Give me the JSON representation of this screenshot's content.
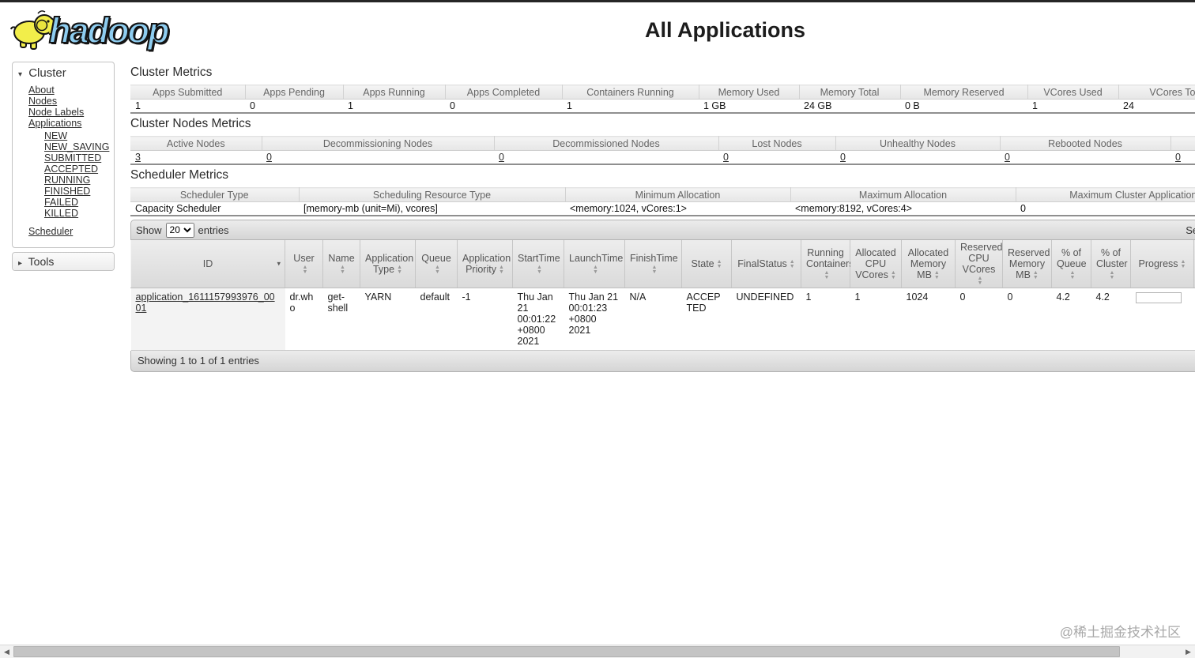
{
  "page": {
    "title": "All Applications",
    "watermark": "@稀土掘金技术社区"
  },
  "logo": {
    "brand": "hadoop",
    "colors": {
      "text_fill": "#8ecdf0",
      "elephant": "#f2ee4a",
      "outline": "#141414"
    }
  },
  "sidebar": {
    "cluster": {
      "label": "Cluster",
      "items": [
        "About",
        "Nodes",
        "Node Labels",
        "Applications"
      ],
      "app_states": [
        "NEW",
        "NEW_SAVING",
        "SUBMITTED",
        "ACCEPTED",
        "RUNNING",
        "FINISHED",
        "FAILED",
        "KILLED"
      ],
      "footer_item": "Scheduler"
    },
    "tools": {
      "label": "Tools"
    }
  },
  "cluster_metrics": {
    "heading": "Cluster Metrics",
    "columns": [
      "Apps Submitted",
      "Apps Pending",
      "Apps Running",
      "Apps Completed",
      "Containers Running",
      "Memory Used",
      "Memory Total",
      "Memory Reserved",
      "VCores Used",
      "VCores Total"
    ],
    "values": [
      "1",
      "0",
      "1",
      "0",
      "1",
      "1 GB",
      "24 GB",
      "0 B",
      "1",
      "24"
    ]
  },
  "cluster_nodes_metrics": {
    "heading": "Cluster Nodes Metrics",
    "columns": [
      "Active Nodes",
      "Decommissioning Nodes",
      "Decommissioned Nodes",
      "Lost Nodes",
      "Unhealthy Nodes",
      "Rebooted Nodes"
    ],
    "values": [
      "3",
      "0",
      "0",
      "0",
      "0",
      "0",
      "0"
    ]
  },
  "scheduler_metrics": {
    "heading": "Scheduler Metrics",
    "columns": [
      "Scheduler Type",
      "Scheduling Resource Type",
      "Minimum Allocation",
      "Maximum Allocation",
      "Maximum Cluster Application Priority"
    ],
    "values": [
      "Capacity Scheduler",
      "[memory-mb (unit=Mi), vcores]",
      "<memory:1024, vCores:1>",
      "<memory:8192, vCores:4>",
      "0"
    ]
  },
  "apps_table": {
    "show_label": "Show",
    "page_size": "20",
    "entries_label": "entries",
    "search_label": "Search:",
    "columns": [
      "ID",
      "User",
      "Name",
      "Application Type",
      "Queue",
      "Application Priority",
      "StartTime",
      "LaunchTime",
      "FinishTime",
      "State",
      "FinalStatus",
      "Running Containers",
      "Allocated CPU VCores",
      "Allocated Memory MB",
      "Reserved CPU VCores",
      "Reserved Memory MB",
      "% of Queue",
      "% of Cluster",
      "Progress"
    ],
    "row": {
      "id": "application_1611157993976_0001",
      "user": "dr.who",
      "name": "get-shell",
      "application_type": "YARN",
      "queue": "default",
      "application_priority": "-1",
      "start_time": "Thu Jan 21 00:01:22 +0800 2021",
      "launch_time": "Thu Jan 21 00:01:23 +0800 2021",
      "finish_time": "N/A",
      "state": "ACCEPTED",
      "final_status": "UNDEFINED",
      "running_containers": "1",
      "allocated_cpu_vcores": "1",
      "allocated_memory_mb": "1024",
      "reserved_cpu_vcores": "0",
      "reserved_memory_mb": "0",
      "pct_of_queue": "4.2",
      "pct_of_cluster": "4.2",
      "progress_percent": 0
    },
    "footer": "Showing 1 to 1 of 1 entries"
  }
}
